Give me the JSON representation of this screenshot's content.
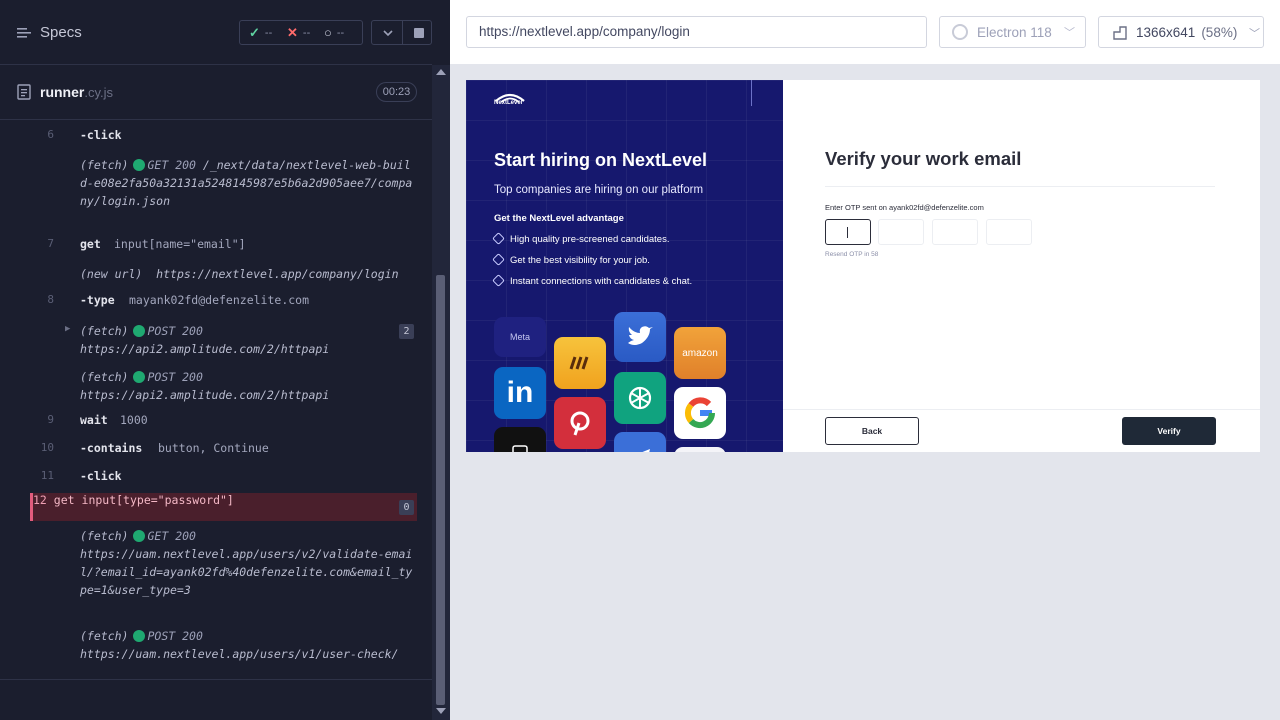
{
  "header": {
    "specs_label": "Specs",
    "stats": {
      "passed": "--",
      "failed": "--",
      "pending": "--"
    }
  },
  "runner": {
    "file_name": "runner",
    "file_ext": ".cy.js",
    "timer": "00:23"
  },
  "commands": [
    {
      "num": "6",
      "name": "-click",
      "msg": ""
    },
    {
      "type": "fetch",
      "method": "GET",
      "status": "200",
      "url": "/_next/data/nextlevel-web-build-e08e2fa50a32131a5248145987e5b6a2d905aee7/company/login.json"
    },
    {
      "num": "7",
      "name": "get",
      "msg": "input[name=\"email\"]"
    },
    {
      "type": "newurl",
      "label": "(new url)",
      "url": "https://nextlevel.app/company/login"
    },
    {
      "num": "8",
      "name": "-type",
      "msg": "mayank02fd@defenzelite.com"
    },
    {
      "type": "fetch",
      "method": "POST",
      "status": "200",
      "url": "https://api2.amplitude.com/2/httpapi",
      "badge": "2"
    },
    {
      "type": "fetch",
      "method": "POST",
      "status": "200",
      "url": "https://api2.amplitude.com/2/httpapi"
    },
    {
      "num": "9",
      "name": "wait",
      "msg": "1000"
    },
    {
      "num": "10",
      "name": "-contains",
      "msg": "button, Continue"
    },
    {
      "num": "11",
      "name": "-click",
      "msg": ""
    },
    {
      "num": "12",
      "name": "get",
      "msg": "input[type=\"password\"]",
      "badge": "0"
    },
    {
      "type": "fetch",
      "method": "GET",
      "status": "200",
      "url": "https://uam.nextlevel.app/users/v2/validate-email/?email_id=ayank02fd%40defenzelite.com&email_type=1&user_type=3"
    },
    {
      "type": "fetch",
      "method": "POST",
      "status": "200",
      "url": "https://uam.nextlevel.app/users/v1/user-check/"
    }
  ],
  "fetch_label": "(fetch)",
  "preview": {
    "url": "https://nextlevel.app/company/login",
    "browser": "Electron 118",
    "viewport": "1366x641",
    "zoom": "(58%)"
  },
  "hero": {
    "logo": "NextLevel",
    "title": "Start hiring on NextLevel",
    "subtitle": "Top companies are hiring on our platform",
    "advantage": "Get the NextLevel advantage",
    "perks": [
      "High quality pre-screened candidates.",
      "Get the best visibility for your job.",
      "Instant connections with candidates & chat."
    ],
    "tiles": [
      "Meta",
      "amazon",
      "in"
    ]
  },
  "form": {
    "title": "Verify your work email",
    "otp_label": "Enter OTP sent on ayank02fd@defenzelite.com",
    "resend": "Resend OTP in 58",
    "back": "Back",
    "verify": "Verify"
  },
  "colors": {
    "pass": "#5fd2a1",
    "fail": "#ff6b6b",
    "active_cmd_bg": "#4a1f2c",
    "hero_bg": "#16186e"
  }
}
